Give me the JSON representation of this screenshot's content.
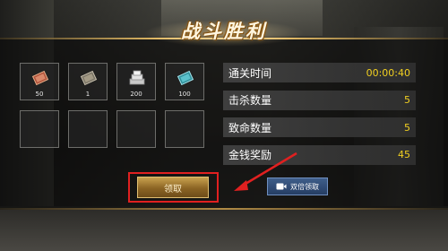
{
  "title": "战斗胜利",
  "rewards": [
    {
      "icon": "red-ticket-icon",
      "count": "50"
    },
    {
      "icon": "gray-ticket-icon",
      "count": "1"
    },
    {
      "icon": "silver-coins-icon",
      "count": "200"
    },
    {
      "icon": "cyan-ticket-icon",
      "count": "100"
    }
  ],
  "empty_slots": 4,
  "stats": [
    {
      "label": "通关时间",
      "value": "00:00:40"
    },
    {
      "label": "击杀数量",
      "value": "5"
    },
    {
      "label": "致命数量",
      "value": "5"
    },
    {
      "label": "金钱奖励",
      "value": "45"
    }
  ],
  "buttons": {
    "claim": "领取",
    "double_claim": "双倍领取"
  },
  "colors": {
    "accent_gold": "#e0b864",
    "stat_value": "#f2d020",
    "highlight_red": "#e02020",
    "double_button": "#3f5e8a"
  }
}
